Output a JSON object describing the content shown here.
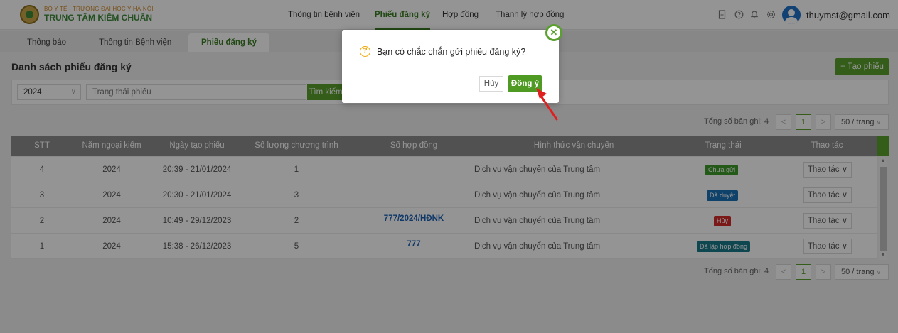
{
  "header": {
    "logo_subtitle": "BỘ Y TẾ - TRƯỜNG ĐẠI HỌC Y HÀ NỘI",
    "logo_title": "TRUNG TÂM KIỂM CHUẨN",
    "nav": [
      "Thông tin bệnh viện",
      "Phiếu đăng ký",
      "Hợp đồng",
      "Thanh lý hợp đồng"
    ],
    "active_nav": "Phiếu đăng ký",
    "icons": [
      "document-icon",
      "help-icon",
      "bell-icon",
      "settings-icon"
    ],
    "user_email": "thuymst@gmail.com"
  },
  "tabs": [
    "Thông báo",
    "Thông tin Bệnh viện",
    "Phiếu đăng ký"
  ],
  "active_tab": "Phiếu đăng ký",
  "page": {
    "title": "Danh sách phiếu đăng ký",
    "create_button": "+ Tạo phiếu"
  },
  "filters": {
    "year": "2024",
    "status_placeholder": "Trạng thái phiếu",
    "search_button": "Tìm kiếm"
  },
  "pagination": {
    "total": "Tổng số bản ghi: 4",
    "prev": "<",
    "current": "1",
    "next": ">",
    "page_size": "50 / trang"
  },
  "table": {
    "columns": [
      "STT",
      "Năm ngoại kiểm",
      "Ngày tạo phiếu",
      "Số lượng chương trình",
      "Số hợp đồng",
      "Hình thức vận chuyển",
      "Trạng thái",
      "Thao tác"
    ],
    "rows": [
      {
        "stt": "4",
        "year": "2024",
        "created": "20:39 - 21/01/2024",
        "programs": "1",
        "contract": "",
        "shipping": "Dịch vụ vận chuyển của Trung tâm",
        "status": "Chưa gửi",
        "status_color": "#3f9b2a",
        "action": "Thao tác ∨"
      },
      {
        "stt": "3",
        "year": "2024",
        "created": "20:30 - 21/01/2024",
        "programs": "3",
        "contract": "",
        "shipping": "Dịch vụ vận chuyển của Trung tâm",
        "status": "Đã duyệt",
        "status_color": "#1a73b8",
        "action": "Thao tác ∨"
      },
      {
        "stt": "2",
        "year": "2024",
        "created": "10:49 - 29/12/2023",
        "programs": "2",
        "contract": "777/2024/HĐNK",
        "shipping": "Dịch vụ vận chuyển của Trung tâm",
        "status": "Hủy",
        "status_color": "#d42b2b",
        "action": "Thao tác ∨"
      },
      {
        "stt": "1",
        "year": "2024",
        "created": "15:38 - 26/12/2023",
        "programs": "5",
        "contract": "777",
        "shipping": "Dịch vụ vận chuyển của Trung tâm",
        "status": "Đã lập hợp đồng",
        "status_color": "#1a7a8c",
        "action": "Thao tác ∨"
      }
    ]
  },
  "dialog": {
    "message": "Bạn có chắc chắn gửi phiếu đăng ký?",
    "cancel": "Hủy",
    "confirm": "Đồng ý",
    "close": "✕",
    "question_mark": "?"
  },
  "colors": {
    "accent": "#5aa02c",
    "header_row": "#8c8c8c",
    "overlay": "rgba(0,0,0,0.42)",
    "arrow": "#e02020"
  }
}
